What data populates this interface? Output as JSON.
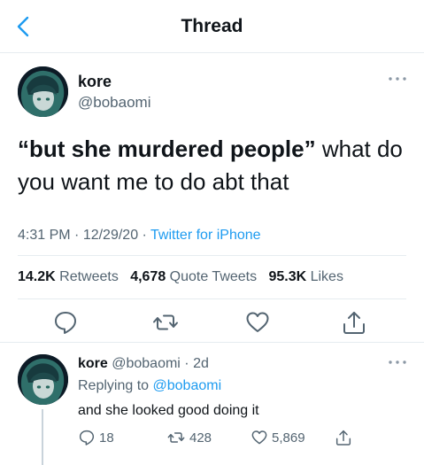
{
  "header": {
    "title": "Thread",
    "back_icon": "chevron-left-icon"
  },
  "colors": {
    "accent": "#1d9bf0",
    "muted": "#536471",
    "text": "#0f1419",
    "divider": "#e6ecf0"
  },
  "main_tweet": {
    "author_name": "kore",
    "author_handle": "@bobaomi",
    "text_bold": "“but she murdered people”",
    "text_rest": " what do you want me to do abt that",
    "time": "4:31 PM",
    "sep1": " · ",
    "date": "12/29/20",
    "sep2": " · ",
    "source": "Twitter for iPhone",
    "retweets_count": "14.2K",
    "retweets_label": " Retweets",
    "quotes_count": "4,678",
    "quotes_label": " Quote Tweets",
    "likes_count": "95.3K",
    "likes_label": " Likes"
  },
  "reply": {
    "author_name": "kore",
    "author_handle": " @bobaomi",
    "age": " · 2d",
    "replying_to_label": "Replying to ",
    "replying_to_handle": "@bobaomi",
    "text": "and she looked good doing it",
    "replies_count": "18",
    "retweets_count": "428",
    "likes_count": "5,869"
  }
}
